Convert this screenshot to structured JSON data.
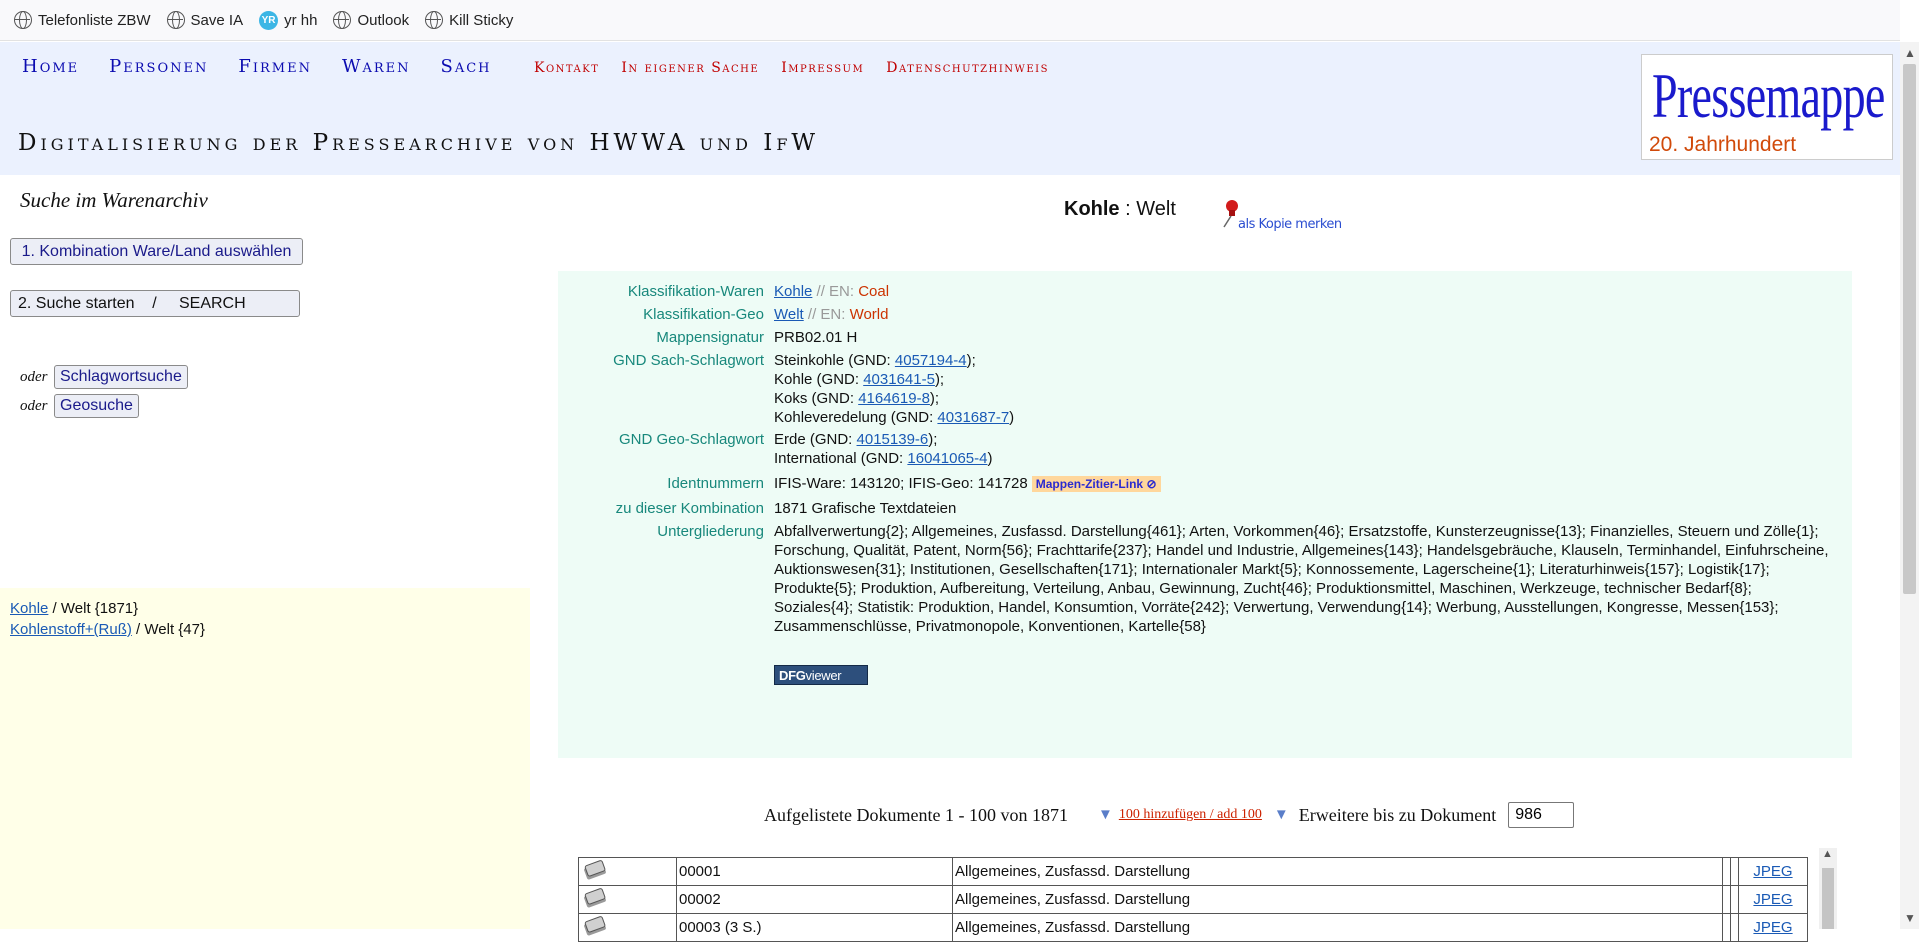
{
  "bookmarks": [
    {
      "label": "Telefonliste ZBW",
      "icon": "globe-icon"
    },
    {
      "label": "Save IA",
      "icon": "globe-icon"
    },
    {
      "label": "yr hh",
      "icon": "yr-icon"
    },
    {
      "label": "Outlook",
      "icon": "globe-icon"
    },
    {
      "label": "Kill Sticky",
      "icon": "globe-icon"
    }
  ],
  "nav_primary": [
    "Home",
    "Personen",
    "Firmen",
    "Waren",
    "Sach"
  ],
  "nav_secondary": [
    "Kontakt",
    "In eigener Sache",
    "Impressum",
    "Datenschutzhinweis"
  ],
  "site_title": "Digitalisierung der Pressearchive von HWWA und IfW",
  "logo": {
    "main": "Pressemappe",
    "sub": "20. Jahrhundert"
  },
  "left": {
    "search_title": "Suche im Warenarchiv",
    "button1": "1. Kombination Ware/Land auswählen",
    "button2": "2. Suche starten    /     SEARCH",
    "oder": "oder",
    "btn_schlagwort": "Schlagwortsuche",
    "btn_geo": "Geosuche",
    "results": [
      {
        "link": "Kohle",
        "rest": " / Welt {1871}"
      },
      {
        "link": "Kohlenstoff+(Ruß)",
        "rest": " / Welt {47}"
      }
    ]
  },
  "main": {
    "head_bold": "Kohle",
    "head_rest": " : Welt",
    "pin_label": "als Kopie merken",
    "info": {
      "klass_waren_label": "Klassifikation-Waren",
      "klass_waren_link": "Kohle",
      "klass_waren_en": " // EN: ",
      "klass_waren_enval": "Coal",
      "klass_geo_label": "Klassifikation-Geo",
      "klass_geo_link": "Welt",
      "klass_geo_en": " // EN: ",
      "klass_geo_enval": "World",
      "mappensignatur_label": "Mappensignatur",
      "mappensignatur": "PRB02.01 H",
      "gnd_sach_label": "GND Sach-Schlagwort",
      "gnd_sach": [
        {
          "pre": "Steinkohle (GND: ",
          "id": "4057194-4",
          "post": ");"
        },
        {
          "pre": "Kohle (GND: ",
          "id": "4031641-5",
          "post": ");"
        },
        {
          "pre": "Koks (GND: ",
          "id": "4164619-8",
          "post": ");"
        },
        {
          "pre": "Kohleveredelung (GND: ",
          "id": "4031687-7",
          "post": ")"
        }
      ],
      "gnd_geo_label": "GND Geo-Schlagwort",
      "gnd_geo": [
        {
          "pre": "Erde (GND: ",
          "id": "4015139-6",
          "post": ");"
        },
        {
          "pre": "International (GND: ",
          "id": "16041065-4",
          "post": ")"
        }
      ],
      "ident_label": "Identnummern",
      "ident": "IFIS-Ware: 143120; IFIS-Geo: 141728",
      "zitier": "Mappen-Zitier-Link",
      "kombi_label": "zu dieser Kombination",
      "kombi": "1871 Grafische Textdateien",
      "unter_label": "Untergliederung",
      "unter": "Abfallverwertung{2}; Allgemeines, Zusfassd. Darstellung{461}; Arten, Vorkommen{46}; Ersatzstoffe, Kunsterzeugnisse{13}; Finanzielles, Steuern und Zölle{1}; Forschung, Qualität, Patent, Norm{56}; Frachttarife{237}; Handel und Industrie, Allgemeines{143}; Handelsgebräuche, Klauseln, Terminhandel, Einfuhrscheine, Auktionswesen{31}; Institutionen, Gesellschaften{171}; Internationaler Markt{5}; Konnossemente, Lagerscheine{1}; Literaturhinweis{157}; Logistik{17}; Produkte{5}; Produktion, Aufbereitung, Verteilung, Anbau, Gewinnung, Zucht{46}; Produktionsmittel, Maschinen, Werkzeuge, technischer Bedarf{8}; Soziales{4}; Statistik: Produktion, Handel, Konsumtion, Vorräte{242}; Verwertung, Verwendung{14}; Werbung, Ausstellungen, Kongresse, Messen{153}; Zusammenschlüsse, Privatmonopole, Konventionen, Kartelle{58}",
      "dfg_bold": "DFG",
      "dfg_rest": "viewer"
    },
    "docbar": {
      "text": "Aufgelistete Dokumente 1 - 100 von 1871",
      "add": "100 hinzufügen / add 100",
      "erweitere": "Erweitere bis zu Dokument",
      "input_value": "986"
    },
    "documents": [
      {
        "num": "00001",
        "title": "Allgemeines, Zusfassd. Darstellung",
        "link": "JPEG"
      },
      {
        "num": "00002",
        "title": "Allgemeines, Zusfassd. Darstellung",
        "link": "JPEG"
      },
      {
        "num": "00003 (3 S.)",
        "title": "Allgemeines, Zusfassd. Darstellung",
        "link": "JPEG"
      }
    ]
  }
}
